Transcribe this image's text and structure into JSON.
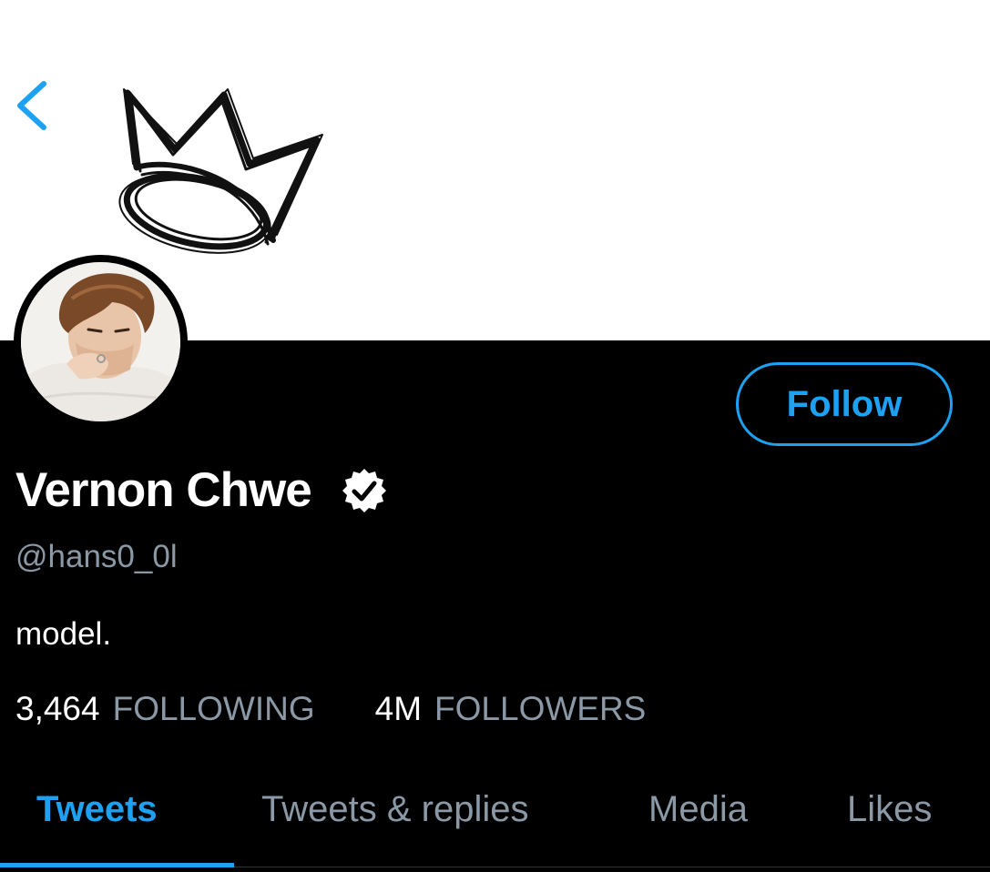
{
  "profile": {
    "display_name": "Vernon Chwe",
    "handle": "@hans0_0l",
    "bio": "model.",
    "verified": true
  },
  "actions": {
    "follow_label": "Follow"
  },
  "stats": {
    "following_count": "3,464",
    "following_label": "FOLLOWING",
    "followers_count": "4M",
    "followers_label": "FOLLOWERS"
  },
  "tabs": [
    {
      "label": "Tweets",
      "active": true
    },
    {
      "label": "Tweets & replies",
      "active": false
    },
    {
      "label": "Media",
      "active": false
    },
    {
      "label": "Likes",
      "active": false
    }
  ],
  "icons": {
    "back": "chevron-left-icon",
    "verified": "verified-badge-icon",
    "banner_art": "crown-drawing"
  },
  "colors": {
    "accent": "#1da1f2",
    "background": "#000000",
    "secondary_text": "#8b98a5",
    "primary_text": "#ffffff",
    "banner": "#ffffff"
  }
}
